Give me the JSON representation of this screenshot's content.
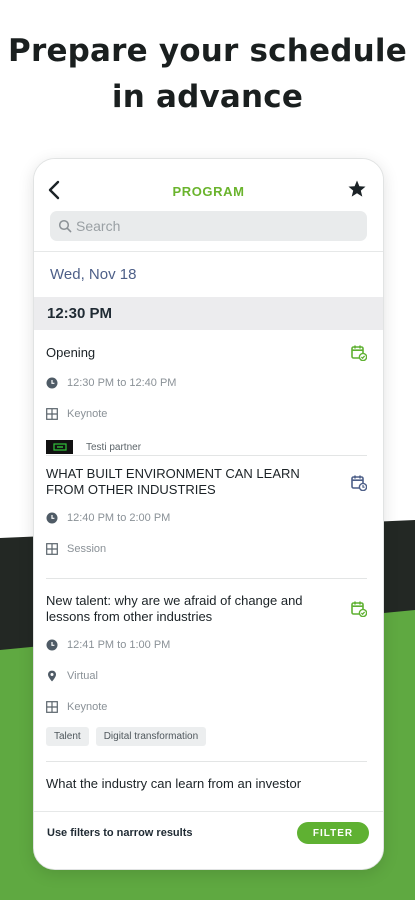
{
  "promo": {
    "headline_line1": "Prepare your schedule",
    "headline_line2": "in advance"
  },
  "app": {
    "title": "PROGRAM",
    "search_placeholder": "Search",
    "date": "Wed, Nov 18",
    "time_group": "12:30 PM"
  },
  "sessions": [
    {
      "title": "Opening",
      "time": "12:30 PM to 12:40 PM",
      "type": "Keynote",
      "partner": "Testi partner",
      "calendar_color": "#5fb132"
    },
    {
      "title": "WHAT BUILT ENVIRONMENT CAN LEARN FROM OTHER INDUSTRIES",
      "time": "12:40 PM to 2:00 PM",
      "type": "Session",
      "calendar_color": "#4d5f88"
    },
    {
      "title": "New talent: why are we afraid of change and lessons from other industries",
      "time": "12:41 PM to 1:00 PM",
      "location": "Virtual",
      "type": "Keynote",
      "tags": [
        "Talent",
        "Digital transformation"
      ],
      "calendar_color": "#5fb132"
    },
    {
      "title": "What the industry can learn from an investor"
    }
  ],
  "bottom": {
    "hint": "Use filters to narrow results",
    "filter_label": "FILTER"
  },
  "colors": {
    "accent_green": "#6ab42d",
    "button_green": "#5fb132",
    "date_blue": "#4d5f88",
    "dark_band": "#232824",
    "green_band": "#5fa941"
  }
}
